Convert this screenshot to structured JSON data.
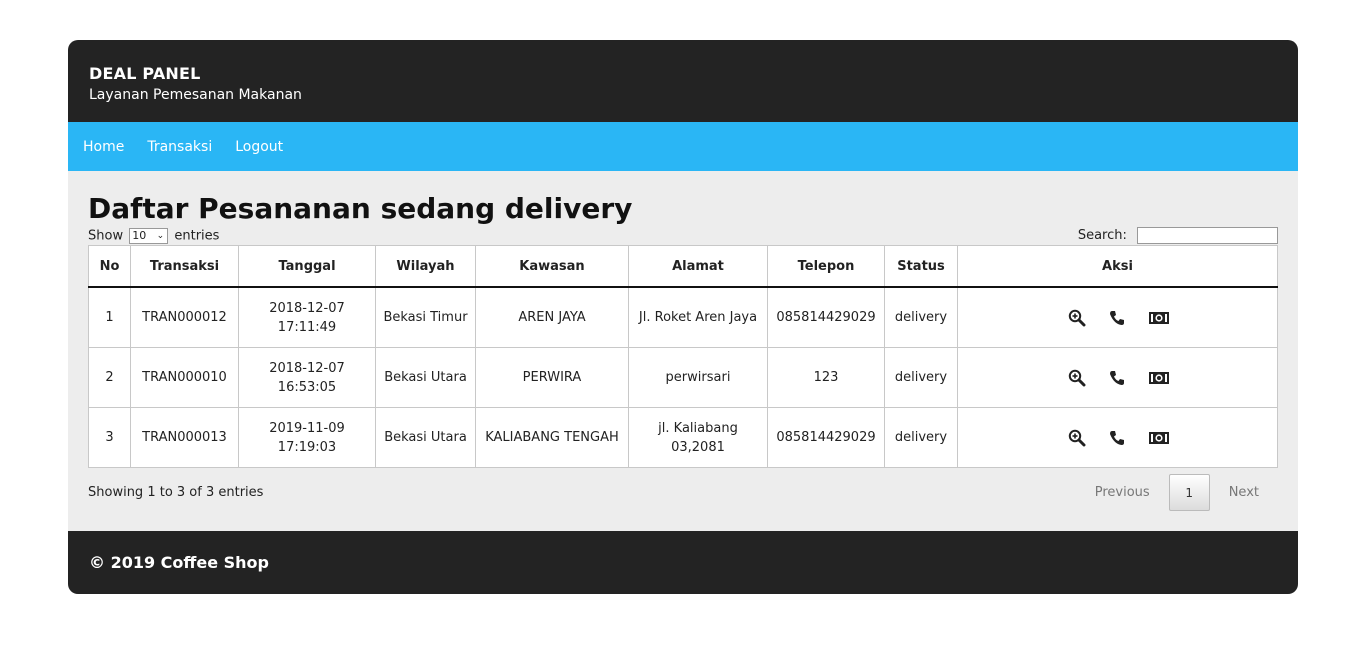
{
  "header": {
    "brand": "DEAL PANEL",
    "tagline": "Layanan Pemesanan Makanan"
  },
  "nav": {
    "items": [
      "Home",
      "Transaksi",
      "Logout"
    ]
  },
  "main": {
    "title": "Daftar Pesananan sedang delivery",
    "show_label": "Show",
    "entries_label": "entries",
    "length_value": "10",
    "search_label": "Search:",
    "search_value": ""
  },
  "table": {
    "headers": [
      "No",
      "Transaksi",
      "Tanggal",
      "Wilayah",
      "Kawasan",
      "Alamat",
      "Telepon",
      "Status",
      "Aksi"
    ],
    "rows": [
      {
        "no": "1",
        "transaksi": "TRAN000012",
        "tanggal": "2018-12-07 17:11:49",
        "wilayah": "Bekasi Timur",
        "kawasan": "AREN JAYA",
        "alamat": "Jl. Roket Aren Jaya",
        "telepon": "085814429029",
        "status": "delivery"
      },
      {
        "no": "2",
        "transaksi": "TRAN000010",
        "tanggal": "2018-12-07 16:53:05",
        "wilayah": "Bekasi Utara",
        "kawasan": "PERWIRA",
        "alamat": "perwirsari",
        "telepon": "123",
        "status": "delivery"
      },
      {
        "no": "3",
        "transaksi": "TRAN000013",
        "tanggal": "2019-11-09 17:19:03",
        "wilayah": "Bekasi Utara",
        "kawasan": "KALIABANG TENGAH",
        "alamat": "jl. Kaliabang 03,2081",
        "telepon": "085814429029",
        "status": "delivery"
      }
    ],
    "action_icons": [
      "zoom-in-icon",
      "phone-icon",
      "money-icon"
    ]
  },
  "pagination": {
    "info": "Showing 1 to 3 of 3 entries",
    "previous": "Previous",
    "page": "1",
    "next": "Next"
  },
  "footer": {
    "text": "© 2019 Coffee Shop"
  },
  "colors": {
    "header_bg": "#232323",
    "nav_bg": "#2ab6f5",
    "content_bg": "#ededed"
  }
}
